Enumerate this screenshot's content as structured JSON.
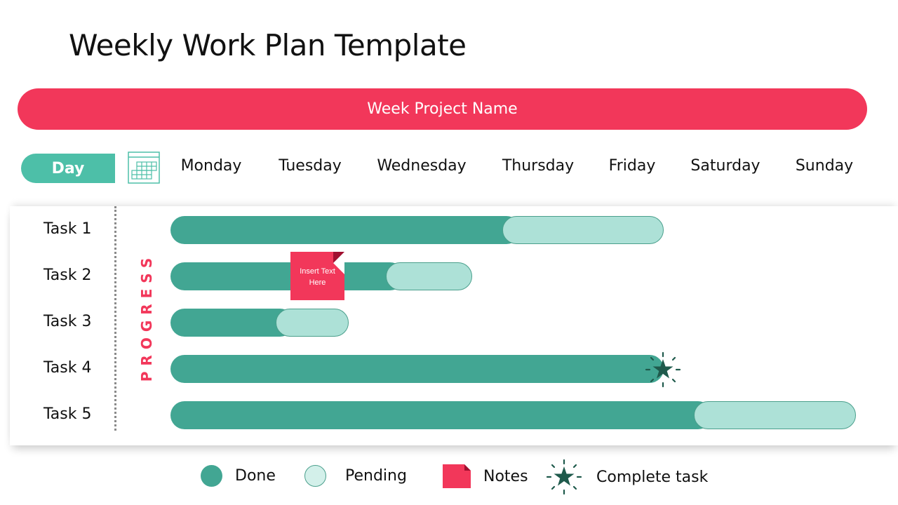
{
  "title": "Weekly Work Plan Template",
  "banner": "Week Project Name",
  "day_label": "Day",
  "days": [
    "Monday",
    "Tuesday",
    "Wednesday",
    "Thursday",
    "Friday",
    "Saturday",
    "Sunday"
  ],
  "progress_label": "PROGRESS",
  "tasks": [
    {
      "label": "Task 1",
      "done_fraction": 0.49,
      "total_fraction": 0.72
    },
    {
      "label": "Task 2",
      "done_fraction": 0.32,
      "total_fraction": 0.44
    },
    {
      "label": "Task 3",
      "done_fraction": 0.16,
      "total_fraction": 0.26
    },
    {
      "label": "Task 4",
      "done_fraction": 0.72,
      "total_fraction": 0.72,
      "complete": true
    },
    {
      "label": "Task 5",
      "done_fraction": 0.77,
      "total_fraction": 1.0
    }
  ],
  "note": {
    "text_line1": "Insert Text",
    "text_line2": "Here",
    "task": "Task 2"
  },
  "legend": {
    "done": "Done",
    "pending": "Pending",
    "notes": "Notes",
    "complete": "Complete task"
  },
  "colors": {
    "accent": "#f2375a",
    "done": "#42a693",
    "pending": "#ade1d7",
    "day_pill": "#4dbfa8",
    "star": "#1f5a4c"
  }
}
